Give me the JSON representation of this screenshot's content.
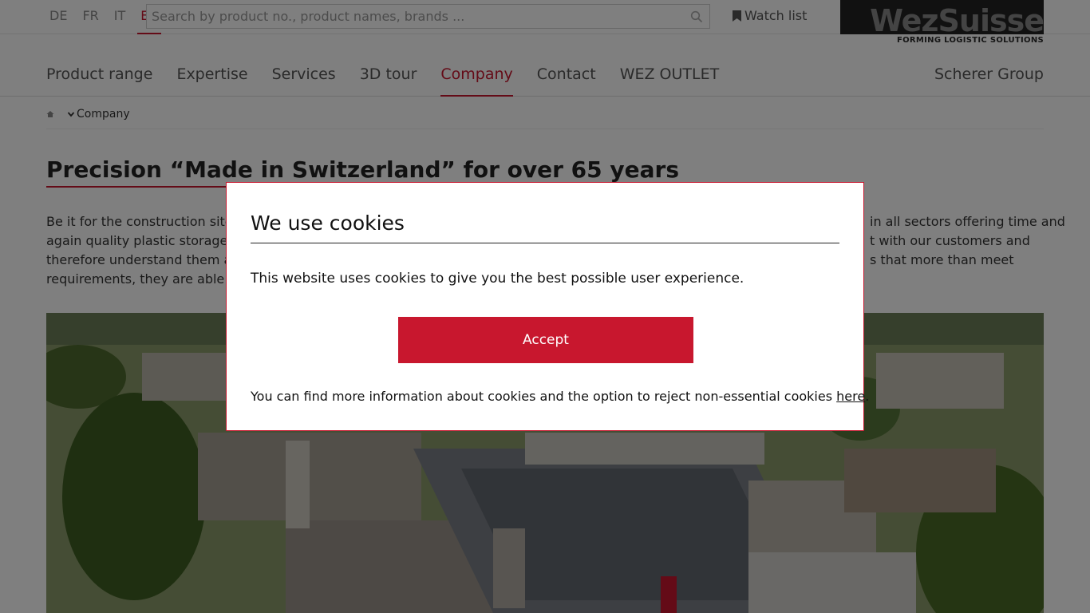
{
  "top": {
    "languages": [
      "DE",
      "FR",
      "IT",
      "EN"
    ],
    "active_language": "EN",
    "search_placeholder": "Search by product no., product names, brands ...",
    "watch_list": "Watch list"
  },
  "logo": {
    "wordmark": "WezSuisse",
    "tagline": "FORMING LOGISTIC SOLUTIONS"
  },
  "nav": {
    "items": [
      "Product range",
      "Expertise",
      "Services",
      "3D tour",
      "Company",
      "Contact",
      "WEZ OUTLET"
    ],
    "active": "Company",
    "group_link": "Scherer Group"
  },
  "breadcrumb": {
    "current": "Company"
  },
  "page": {
    "title": "Precision “Made in Switzerland” for over 65 years",
    "paragraph_lines": [
      "Be it for the construction sites",
      "again quality plastic storage so",
      "therefore understand them as",
      "requirements, they are able to"
    ],
    "paragraph_lines_right": [
      "in all sectors offering time and",
      "t with our customers and",
      "s that more than meet",
      ""
    ]
  },
  "cookie": {
    "title": "We use cookies",
    "message": "This website uses cookies to give you the best possible user experience.",
    "accept": "Accept",
    "info_text": "You can find more information about cookies and the option to reject non-essential cookies ",
    "link_text": "here",
    "info_suffix": "."
  },
  "colors": {
    "accent": "#c8172e"
  },
  "icons": [
    "search-icon",
    "bookmark-icon",
    "home-icon",
    "chevron-down-icon"
  ]
}
